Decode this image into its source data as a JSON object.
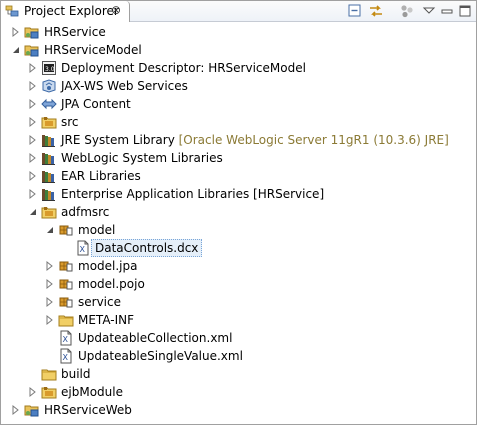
{
  "view": {
    "title": "Project Explorer",
    "close_glyph": "⊗",
    "toolbar": [
      {
        "name": "collapse-all-button",
        "icon": "collapse-all-icon"
      },
      {
        "name": "link-with-editor-button",
        "icon": "link-with-editor-icon"
      },
      {
        "name": "focus-button",
        "icon": "focus-icon"
      },
      {
        "name": "view-menu-button",
        "icon": "view-menu-icon"
      },
      {
        "name": "minimize-button",
        "icon": "minimize-icon"
      },
      {
        "name": "maximize-button",
        "icon": "maximize-icon"
      }
    ]
  },
  "tree": [
    {
      "label": "HRService",
      "depth": 0,
      "state": "collapsed",
      "icon": "project-icon"
    },
    {
      "label": "HRServiceModel",
      "depth": 0,
      "state": "expanded",
      "icon": "project-icon"
    },
    {
      "label": "Deployment Descriptor: HRServiceModel",
      "depth": 1,
      "state": "collapsed",
      "icon": "deployment-descriptor-icon"
    },
    {
      "label": "JAX-WS Web Services",
      "depth": 1,
      "state": "collapsed",
      "icon": "web-services-icon"
    },
    {
      "label": "JPA Content",
      "depth": 1,
      "state": "collapsed",
      "icon": "jpa-content-icon"
    },
    {
      "label": "src",
      "depth": 1,
      "state": "collapsed",
      "icon": "source-folder-icon"
    },
    {
      "label": "JRE System Library",
      "decoration": "[Oracle WebLogic Server 11gR1 (10.3.6) JRE]",
      "depth": 1,
      "state": "collapsed",
      "icon": "library-icon"
    },
    {
      "label": "WebLogic System Libraries",
      "depth": 1,
      "state": "collapsed",
      "icon": "library-icon"
    },
    {
      "label": "EAR Libraries",
      "depth": 1,
      "state": "collapsed",
      "icon": "library-icon"
    },
    {
      "label": "Enterprise Application Libraries [HRService]",
      "depth": 1,
      "state": "collapsed",
      "icon": "library-icon"
    },
    {
      "label": "adfmsrc",
      "depth": 1,
      "state": "expanded",
      "icon": "source-folder-icon"
    },
    {
      "label": "model",
      "depth": 2,
      "state": "expanded",
      "icon": "package-icon"
    },
    {
      "label": "DataControls.dcx",
      "depth": 3,
      "state": "leaf",
      "icon": "xml-file-icon",
      "selected": true
    },
    {
      "label": "model.jpa",
      "depth": 2,
      "state": "collapsed",
      "icon": "package-icon"
    },
    {
      "label": "model.pojo",
      "depth": 2,
      "state": "collapsed",
      "icon": "package-icon"
    },
    {
      "label": "service",
      "depth": 2,
      "state": "collapsed",
      "icon": "package-icon"
    },
    {
      "label": "META-INF",
      "depth": 2,
      "state": "collapsed",
      "icon": "folder-icon"
    },
    {
      "label": "UpdateableCollection.xml",
      "depth": 2,
      "state": "leaf",
      "icon": "xml-file-icon"
    },
    {
      "label": "UpdateableSingleValue.xml",
      "depth": 2,
      "state": "leaf",
      "icon": "xml-file-icon"
    },
    {
      "label": "build",
      "depth": 1,
      "state": "leaf",
      "icon": "folder-icon"
    },
    {
      "label": "ejbModule",
      "depth": 1,
      "state": "collapsed",
      "icon": "source-folder-icon"
    },
    {
      "label": "HRServiceWeb",
      "depth": 0,
      "state": "collapsed",
      "icon": "project-icon"
    }
  ]
}
